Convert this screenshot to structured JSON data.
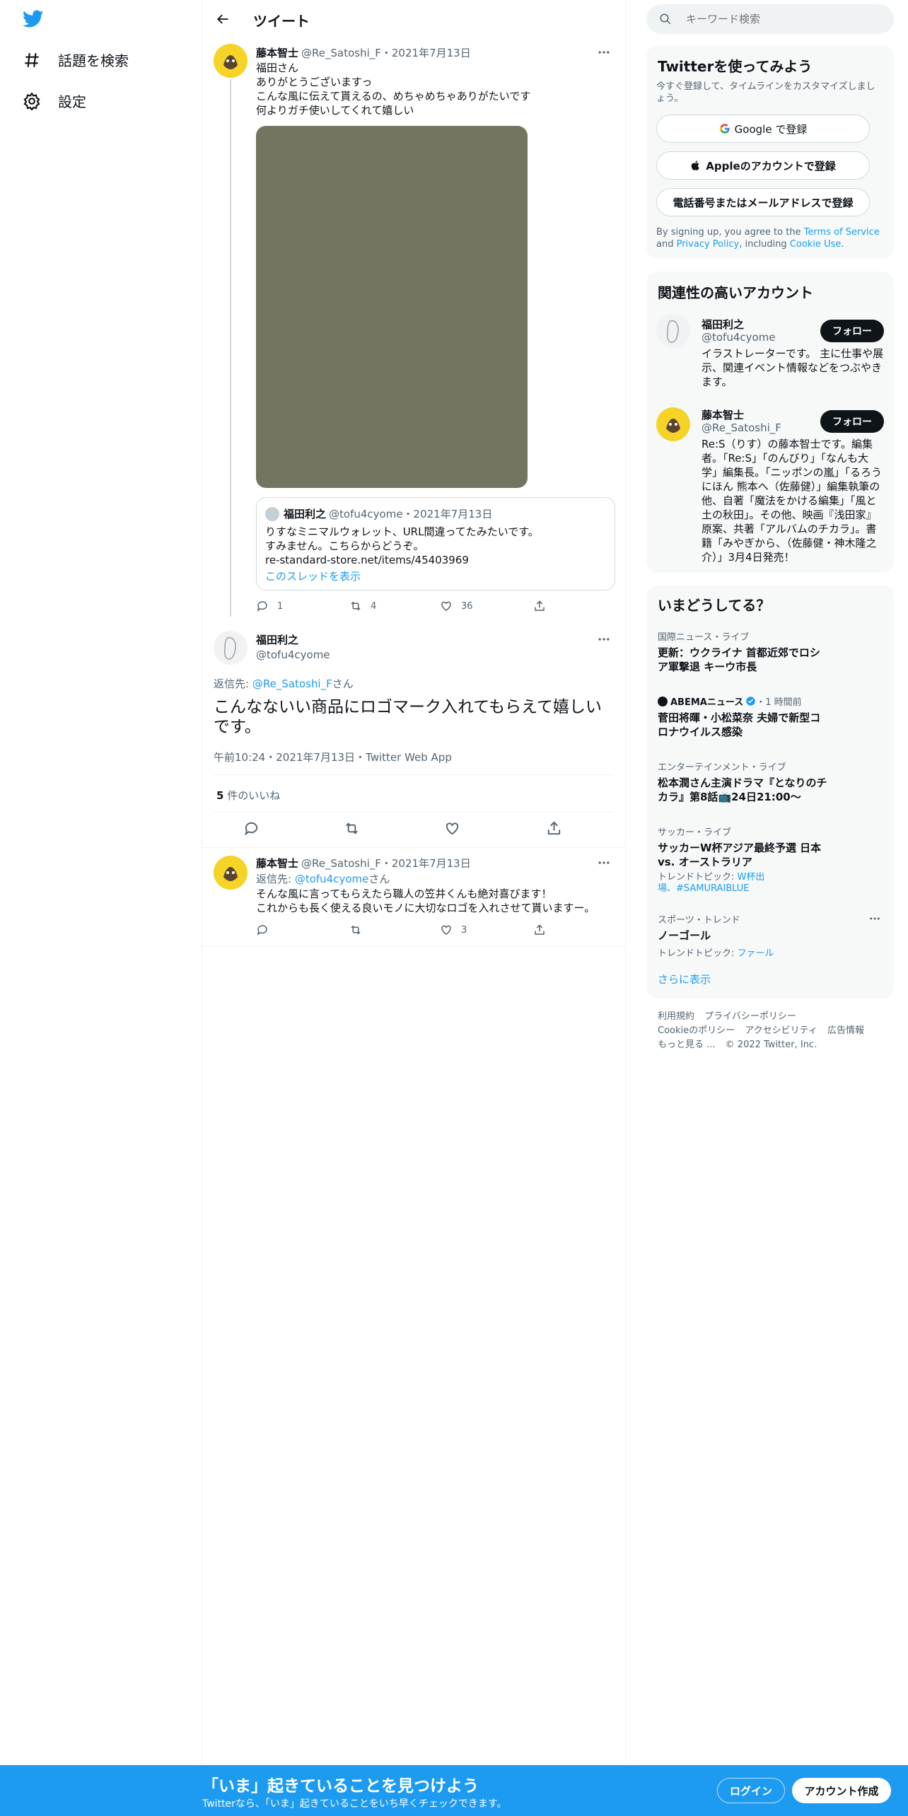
{
  "nav": {
    "explore_label": "話題を検索",
    "settings_label": "設定"
  },
  "header": {
    "title": "ツイート"
  },
  "tweet1": {
    "name": "藤本智士",
    "handle": "@Re_Satoshi_F",
    "date": "・2021年7月13日",
    "lines": [
      "福田さん",
      "ありがとうございますっ",
      "こんな風に伝えて貰えるの、めちゃめちゃありがたいです",
      "何よりガチ使いしてくれて嬉しい"
    ],
    "quote": {
      "name": "福田利之",
      "handle": "@tofu4cyome",
      "date": "・2021年7月13日",
      "lines": [
        "りすなミニマルウォレット、URL間違ってたみたいです。",
        "すみません。こちらからどうぞ。",
        "re-standard-store.net/items/45403969"
      ],
      "thread_link": "このスレッドを表示"
    },
    "reply_count": "1",
    "retweet_count": "4",
    "like_count": "36"
  },
  "main_tweet": {
    "name": "福田利之",
    "handle": "@tofu4cyome",
    "reply_prefix": "返信先: ",
    "reply_to": "@Re_Satoshi_F",
    "reply_suffix": "さん",
    "text": "こんなないい商品にロゴマーク入れてもらえて嬉しいです。",
    "meta": "午前10:24・2021年7月13日・Twitter Web App",
    "likes_count": "5",
    "likes_label": " 件のいいね"
  },
  "reply_tweet": {
    "name": "藤本智士",
    "handle": "@Re_Satoshi_F",
    "date": "・2021年7月13日",
    "reply_prefix": "返信先: ",
    "reply_to": "@tofu4cyome",
    "reply_suffix": "さん",
    "lines": [
      "そんな風に言ってもらえたら職人の笠井くんも絶対喜びます！",
      "これからも長く使える良いモノに大切なロゴを入れさせて貰いますー。"
    ],
    "reply_count": "",
    "retweet_count": "",
    "like_count": "3"
  },
  "search": {
    "placeholder": "キーワード検索"
  },
  "signup": {
    "title": "Twitterを使ってみよう",
    "subtitle": "今すぐ登録して、タイムラインをカスタマイズしましょう。",
    "google": "Google で登録",
    "apple": "Appleのアカウントで登録",
    "phone": "電話番号またはメールアドレスで登録",
    "terms_1": "By signing up, you agree to the ",
    "terms_link1": "Terms of Service",
    "terms_2": " and ",
    "terms_link2": "Privacy Policy",
    "terms_3": ", including ",
    "terms_link3": "Cookie Use",
    "terms_4": "."
  },
  "related": {
    "title": "関連性の高いアカウント",
    "follow_label": "フォロー",
    "accounts": [
      {
        "name": "福田利之",
        "handle": "@tofu4cyome",
        "bio": "イラストレーターです。 主に仕事や展示、関連イベント情報などをつぶやきます。"
      },
      {
        "name": "藤本智士",
        "handle": "@Re_Satoshi_F",
        "bio": "Re:S（りす）の藤本智士です。編集者。「Re:S」「のんびり」「なんも大学」編集長。「ニッポンの嵐」「るろうにほん 熊本へ（佐藤健）」編集執筆の他、自著「魔法をかける編集」「風と土の秋田」。その他、映画『浅田家』原案、共著「アルバムのチカラ」。書籍「みやぎから、（佐藤健・神木隆之介）」3月4日発売！"
      }
    ]
  },
  "trends": {
    "title": "いまどうしてる？",
    "items": [
      {
        "category": "国際ニュース・ライブ",
        "title": "更新：ウクライナ 首都近郊でロシア軍撃退 キーウ市長",
        "topic_prefix": "",
        "topic": ""
      },
      {
        "category": "ABEMAニュース",
        "time": "・1 時間前",
        "title": "菅田将暉・小松菜奈 夫婦で新型コロナウイルス感染",
        "topic_prefix": "",
        "topic": ""
      },
      {
        "category": "エンターテインメント・ライブ",
        "title": "松本潤さん主演ドラマ『となりのチカラ』第8話📺24日21:00〜",
        "topic_prefix": "",
        "topic": ""
      },
      {
        "category": "サッカー・ライブ",
        "title": "サッカーW杯アジア最終予選 日本 vs. オーストラリア",
        "topic_prefix": "トレンドトピック: ",
        "topic": "W杯出場、#SAMURAIBLUE"
      },
      {
        "category": "スポーツ・トレンド",
        "title": "ノーゴール",
        "topic_prefix": "トレンドトピック: ",
        "topic": "ファール"
      }
    ],
    "show_more": "さらに表示"
  },
  "footer": {
    "line1": [
      "利用規約",
      "プライバシーポリシー"
    ],
    "line2": [
      "Cookieのポリシー",
      "アクセシビリティ",
      "広告情報"
    ],
    "more": "もっと見る ...",
    "copyright": "© 2022 Twitter, Inc."
  },
  "bottom_bar": {
    "title": "「いま」起きていることを見つけよう",
    "subtitle": "Twitterなら、「いま」起きていることをいち早くチェックできます。",
    "login": "ログイン",
    "signup": "アカウント作成"
  },
  "colors": {
    "accent": "#1d9bf0",
    "text": "#0f1419",
    "muted": "#536471",
    "media_placeholder": "#737561"
  }
}
